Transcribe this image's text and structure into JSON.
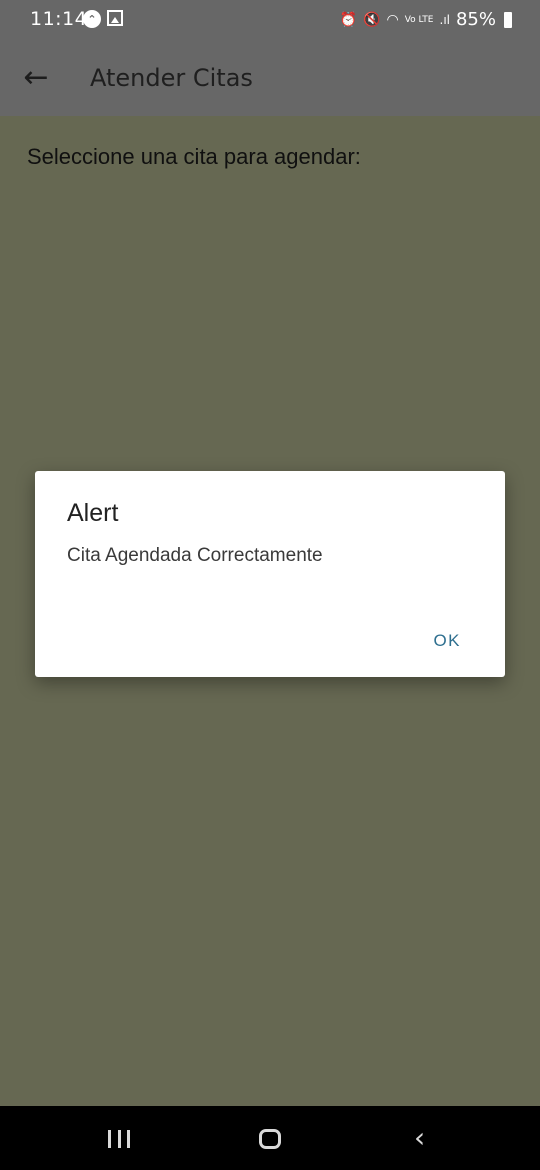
{
  "status_bar": {
    "time": "11:14",
    "battery": "85%",
    "icons": [
      "navigation-icon",
      "image-icon",
      "alarm-icon",
      "mute-icon",
      "wifi-icon",
      "volte-icon",
      "signal-icon",
      "battery-icon"
    ]
  },
  "app_bar": {
    "title": "Atender Citas",
    "back_icon": "back-arrow-icon"
  },
  "content": {
    "prompt": "Seleccione una cita para agendar:"
  },
  "alert": {
    "title": "Alert",
    "message": "Cita Agendada Correctamente",
    "ok_label": "OK"
  },
  "nav_bar": {
    "icons": [
      "recent-apps-icon",
      "home-icon",
      "back-icon"
    ]
  },
  "colors": {
    "app_bar": "#676767",
    "content_overlay": "#666852",
    "accent": "#2e6f8f"
  }
}
